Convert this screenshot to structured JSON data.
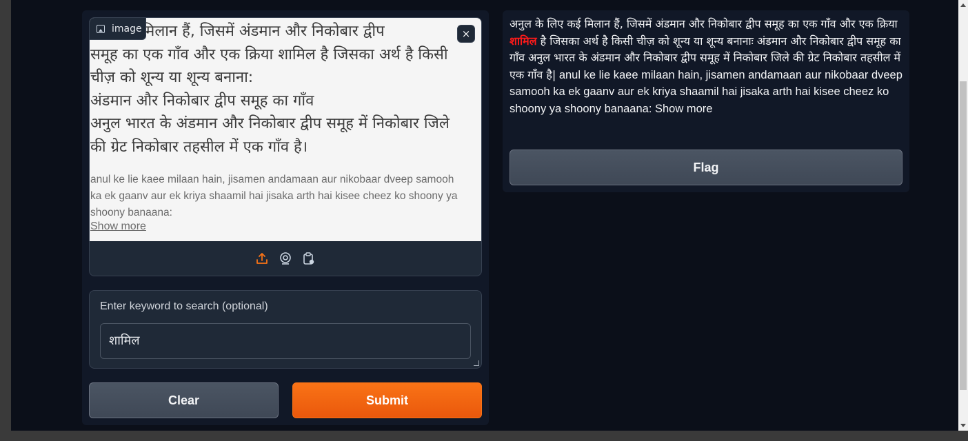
{
  "image_input": {
    "label": "image",
    "close_symbol": "×",
    "image_text_hindi": "लिए कई मिलान हैं, जिसमें अंडमान और निकोबार द्वीप\nसमूह का एक गाँव और एक क्रिया शामिल है जिसका अर्थ है किसी\nचीज़ को शून्य या शून्य बनाना:\nअंडमान और निकोबार द्वीप समूह का गाँव\nअनुल भारत के अंडमान और निकोबार द्वीप समूह में निकोबार जिले\nकी ग्रेट निकोबार तहसील में एक गाँव है।",
    "image_text_roman": "anul ke lie kaee milaan hain, jisamen andamaan aur nikobaar dveep samooh ka ek gaanv aur ek kriya shaamil hai jisaka arth hai kisee cheez ko shoony ya shoony banaana:",
    "image_show_more": "Show more",
    "sources": [
      "upload-icon",
      "webcam-icon",
      "clipboard-icon"
    ]
  },
  "keyword": {
    "label": "Enter keyword to search (optional)",
    "value": "शामिल"
  },
  "buttons": {
    "clear": "Clear",
    "submit": "Submit",
    "flag": "Flag"
  },
  "output": {
    "text_before": "अनुल के लिए कई मिलान हैं, जिसमें अंडमान और निकोबार द्वीप समूह का एक गाँव और एक क्रिया ",
    "highlight": "शामिल",
    "text_after": " है जिसका अर्थ है किसी चीज़ को शून्य या शून्य बनानाः अंडमान और निकोबार द्वीप समूह का गाँव अनुल भारत के अंडमान और निकोबार द्वीप समूह में निकोबार जिले की ग्रेट निकोबार तहसील में एक गाँव है|",
    "text_roman": " anul ke lie kaee milaan hain, jisamen andamaan aur nikobaar dveep samooh ka ek gaanv aur ek kriya shaamil hai jisaka arth hai kisee cheez ko shoony ya shoony banaana: Show more"
  },
  "colors": {
    "accent": "#f97316",
    "highlight": "#ff1a1a",
    "panel": "#111827",
    "background": "#0b0f19"
  }
}
